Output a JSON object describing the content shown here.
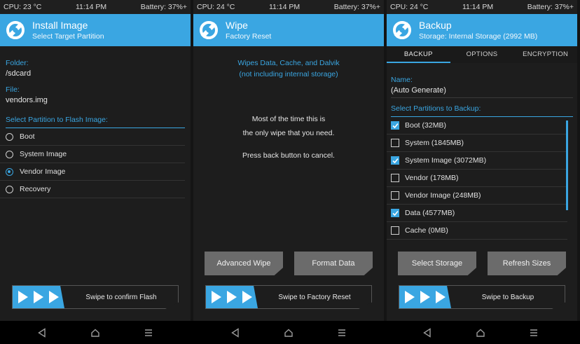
{
  "status_bars": [
    {
      "cpu": "CPU: 23 °C",
      "time": "11:14 PM",
      "battery": "Battery: 37%+"
    },
    {
      "cpu": "CPU: 24 °C",
      "time": "11:14 PM",
      "battery": "Battery: 37%+"
    },
    {
      "cpu": "CPU: 24 °C",
      "time": "11:14 PM",
      "battery": "Battery: 37%+"
    }
  ],
  "install": {
    "title": "Install Image",
    "subtitle": "Select Target Partition",
    "folder_label": "Folder:",
    "folder_value": "/sdcard",
    "file_label": "File:",
    "file_value": "vendors.img",
    "select_label": "Select Partition to Flash Image:",
    "options": [
      {
        "label": "Boot",
        "selected": false
      },
      {
        "label": "System Image",
        "selected": false
      },
      {
        "label": "Vendor Image",
        "selected": true
      },
      {
        "label": "Recovery",
        "selected": false
      }
    ],
    "swipe_label": "Swipe to confirm Flash"
  },
  "wipe": {
    "title": "Wipe",
    "subtitle": "Factory Reset",
    "info_line1": "Wipes Data, Cache, and Dalvik",
    "info_line2": "(not including internal storage)",
    "msg_line1": "Most of the time this is",
    "msg_line2": "the only wipe that you need.",
    "msg_line3": "Press back button to cancel.",
    "advanced_button": "Advanced Wipe",
    "format_button": "Format Data",
    "swipe_label": "Swipe to Factory Reset"
  },
  "backup": {
    "title": "Backup",
    "subtitle": "Storage: Internal Storage (2992 MB)",
    "tabs": [
      "BACKUP",
      "OPTIONS",
      "ENCRYPTION"
    ],
    "name_label": "Name:",
    "name_value": "(Auto Generate)",
    "select_label": "Select Partitions to Backup:",
    "partitions": [
      {
        "label": "Boot (32MB)",
        "checked": true
      },
      {
        "label": "System (1845MB)",
        "checked": false
      },
      {
        "label": "System Image (3072MB)",
        "checked": true
      },
      {
        "label": "Vendor (178MB)",
        "checked": false
      },
      {
        "label": "Vendor Image (248MB)",
        "checked": false
      },
      {
        "label": "Data (4577MB)",
        "checked": true
      },
      {
        "label": "Cache (0MB)",
        "checked": false
      }
    ],
    "select_storage_button": "Select Storage",
    "refresh_button": "Refresh Sizes",
    "swipe_label": "Swipe to Backup"
  },
  "colors": {
    "accent": "#3aa6e2",
    "background": "#1d1d1d",
    "button": "#6b6b6b"
  },
  "icons": [
    "twrp-logo-icon",
    "check-icon",
    "back-icon",
    "home-icon",
    "menu-icon"
  ]
}
